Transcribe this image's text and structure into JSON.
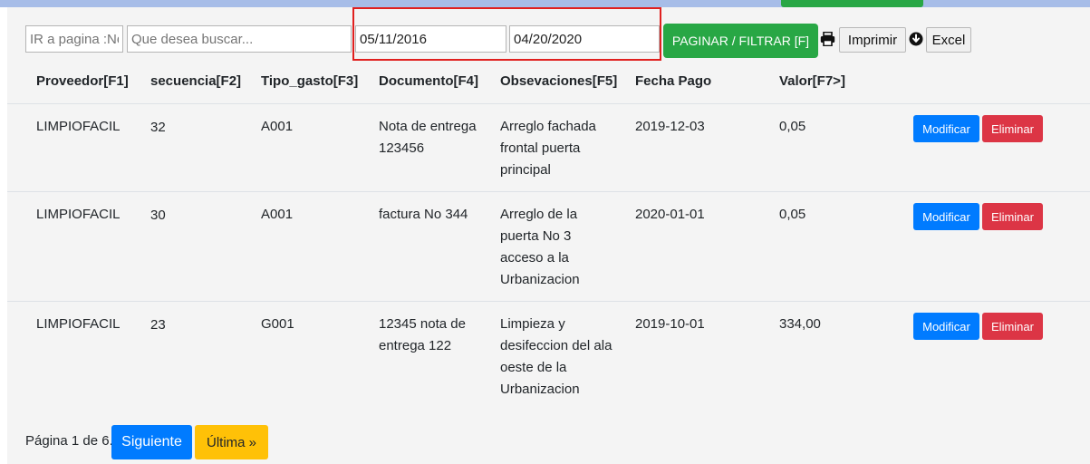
{
  "toolbar": {
    "goto_page_placeholder": "IR a pagina :No",
    "search_placeholder": "Que desea buscar...",
    "date_from": "05/11/2016",
    "date_to": "04/20/2020",
    "paginate_label": "PAGINAR / FILTRAR [F]",
    "print_label": "Imprimir",
    "excel_label": "Excel",
    "print_icon": "printer-icon",
    "download_icon": "download-circle-icon"
  },
  "table": {
    "headers": [
      "Proveedor[F1]",
      "secuencia[F2]",
      "Tipo_gasto[F3]",
      "Documento[F4]",
      "Obsevaciones[F5]",
      "Fecha Pago",
      "Valor[F7>]"
    ],
    "rows": [
      {
        "proveedor": "LIMPIOFACIL",
        "secuencia": "32",
        "tipo": "A001",
        "documento": [
          "Nota de entrega",
          "123456"
        ],
        "observaciones": [
          "Arreglo fachada",
          "frontal puerta",
          "principal"
        ],
        "fecha": "2019-12-03",
        "valor": "0,05",
        "modify_label": "Modificar",
        "delete_label": "Eliminar"
      },
      {
        "proveedor": "LIMPIOFACIL",
        "secuencia": "30",
        "tipo": "A001",
        "documento": [
          "factura No 344"
        ],
        "observaciones": [
          "Arreglo de la",
          "puerta No 3",
          "acceso a la",
          "Urbanizacion"
        ],
        "fecha": "2020-01-01",
        "valor": "0,05",
        "modify_label": "Modificar",
        "delete_label": "Eliminar"
      },
      {
        "proveedor": "LIMPIOFACIL",
        "secuencia": "23",
        "tipo": "G001",
        "documento": [
          "12345 nota de",
          "entrega 122"
        ],
        "observaciones": [
          "Limpieza y",
          "desifeccion del ala",
          "oeste de la",
          "Urbanizacion"
        ],
        "fecha": "2019-10-01",
        "valor": "334,00",
        "modify_label": "Modificar",
        "delete_label": "Eliminar"
      }
    ]
  },
  "pagination": {
    "info": "Página 1 de 6.",
    "next_label": "Siguiente",
    "last_label": "Última »"
  },
  "colors": {
    "success": "#28a745",
    "primary": "#007bff",
    "danger": "#dc3545",
    "warning": "#ffc107",
    "highlight_border": "#e0201f"
  }
}
